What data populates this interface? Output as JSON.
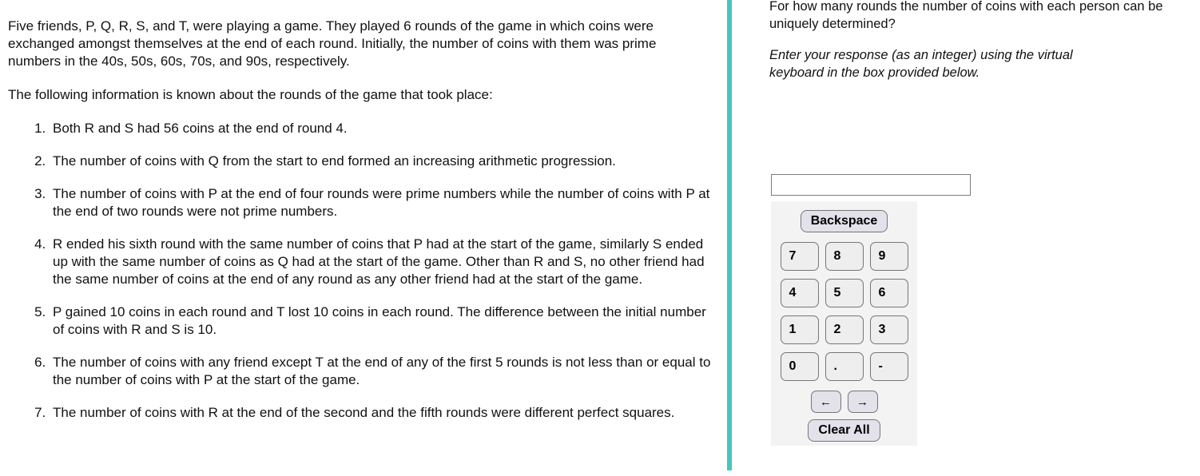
{
  "colors": {
    "divider_teal": "#46c4c0",
    "keypad_background": "#f3f3f3",
    "key_face": "#eeeeee",
    "key_action_face": "#e3e1ea",
    "key_border": "#767676",
    "text": "#111111"
  },
  "passage": {
    "intro": "Five friends, P, Q, R, S, and T, were playing a game. They played 6 rounds of the game in which coins were exchanged amongst themselves at the end of each round. Initially, the number of coins with them was prime numbers in the 40s, 50s, 60s, 70s, and 90s, respectively.",
    "lead_in": "The following information is known about the rounds of the game that took place:",
    "clues": [
      "Both R and S had 56 coins at the end of round 4.",
      "The number of coins with Q from the start to end formed an increasing arithmetic progression.",
      "The number of coins with P at the end of four rounds were prime numbers while the number of coins with P at the end of two rounds were not prime numbers.",
      "R ended his sixth round with the same number of coins that P had at the start of the game, similarly S ended up with the same number of coins as Q had at the start of the game. Other than R and S, no other friend had the same number of coins at the end of any round as any other friend had at the start of the game.",
      "P gained 10 coins in each round and T lost 10 coins in each round. The difference between the initial number of coins with R and S is 10.",
      "The number of coins with any friend except T at the end of any of the first 5 rounds is not less than or equal to the number of coins with P at the start of the game.",
      "The number of coins with R at the end of the second and the fifth rounds were different perfect squares."
    ]
  },
  "answer_panel": {
    "question": "For how many rounds the number of coins with each person can be uniquely determined?",
    "instruction": "Enter your response (as an integer) using the virtual keyboard in the box provided below.",
    "input": {
      "value": "",
      "placeholder": ""
    },
    "keypad": {
      "backspace_label": "Backspace",
      "rows": [
        [
          "7",
          "8",
          "9"
        ],
        [
          "4",
          "5",
          "6"
        ],
        [
          "1",
          "2",
          "3"
        ],
        [
          "0",
          ".",
          "-"
        ]
      ],
      "arrow_left_label": "←",
      "arrow_right_label": "→",
      "clear_all_label": "Clear All"
    }
  }
}
